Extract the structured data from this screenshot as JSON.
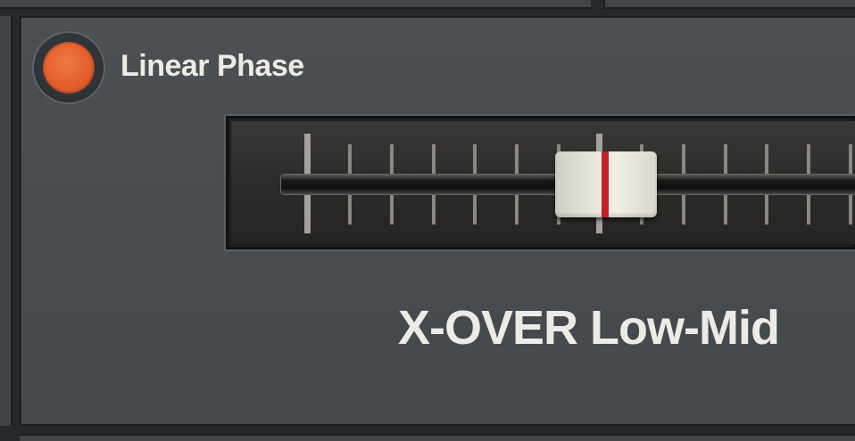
{
  "linear_phase": {
    "label": "Linear Phase",
    "led_color": "#e45f2d",
    "state": "on"
  },
  "fader": {
    "label": "X-OVER Low-Mid",
    "cap_line_color": "#c02227",
    "position_fraction": 0.61
  }
}
